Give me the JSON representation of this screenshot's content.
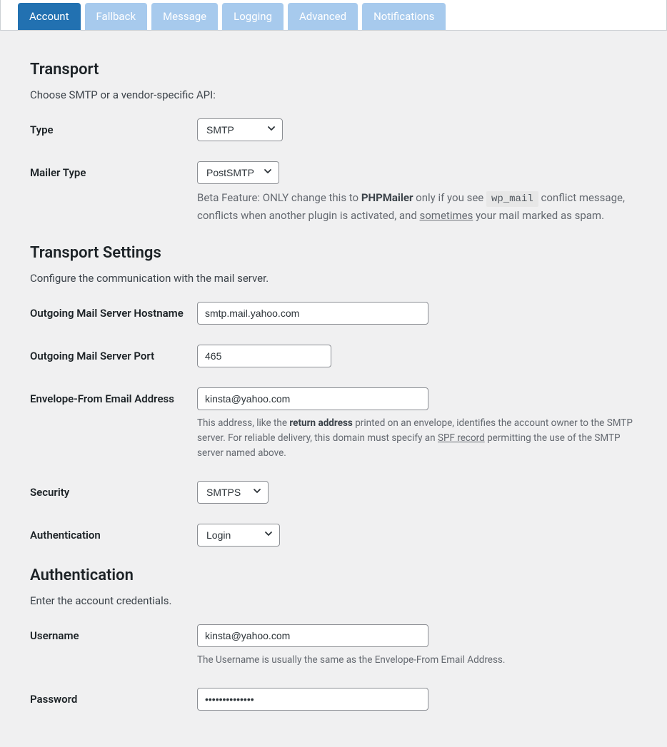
{
  "tabs": [
    {
      "label": "Account",
      "active": true
    },
    {
      "label": "Fallback",
      "active": false
    },
    {
      "label": "Message",
      "active": false
    },
    {
      "label": "Logging",
      "active": false
    },
    {
      "label": "Advanced",
      "active": false
    },
    {
      "label": "Notifications",
      "active": false
    }
  ],
  "sections": {
    "transport": {
      "heading": "Transport",
      "desc": "Choose SMTP or a vendor-specific API:",
      "type_label": "Type",
      "type_value": "SMTP",
      "mailer_type_label": "Mailer Type",
      "mailer_type_value": "PostSMTP",
      "mailer_help_prefix": "Beta Feature: ONLY change this to ",
      "mailer_help_bold": "PHPMailer",
      "mailer_help_mid1": " only if you see ",
      "mailer_help_code": "wp_mail",
      "mailer_help_mid2": " conflict message, conflicts when another plugin is activated, and ",
      "mailer_help_ul": "sometimes",
      "mailer_help_end": " your mail marked as spam."
    },
    "transport_settings": {
      "heading": "Transport Settings",
      "desc": "Configure the communication with the mail server.",
      "hostname_label": "Outgoing Mail Server Hostname",
      "hostname_value": "smtp.mail.yahoo.com",
      "port_label": "Outgoing Mail Server Port",
      "port_value": "465",
      "envelope_label": "Envelope-From Email Address",
      "envelope_value": "kinsta@yahoo.com",
      "envelope_help_prefix": "This address, like the ",
      "envelope_help_bold": "return address",
      "envelope_help_mid1": " printed on an envelope, identifies the account owner to the SMTP server. For reliable delivery, this domain must specify an ",
      "envelope_help_ul": "SPF record",
      "envelope_help_end": " permitting the use of the SMTP server named above.",
      "security_label": "Security",
      "security_value": "SMTPS",
      "auth_label": "Authentication",
      "auth_value": "Login"
    },
    "authentication": {
      "heading": "Authentication",
      "desc": "Enter the account credentials.",
      "username_label": "Username",
      "username_value": "kinsta@yahoo.com",
      "username_help": "The Username is usually the same as the Envelope-From Email Address.",
      "password_label": "Password",
      "password_value": "••••••••••••••"
    }
  }
}
